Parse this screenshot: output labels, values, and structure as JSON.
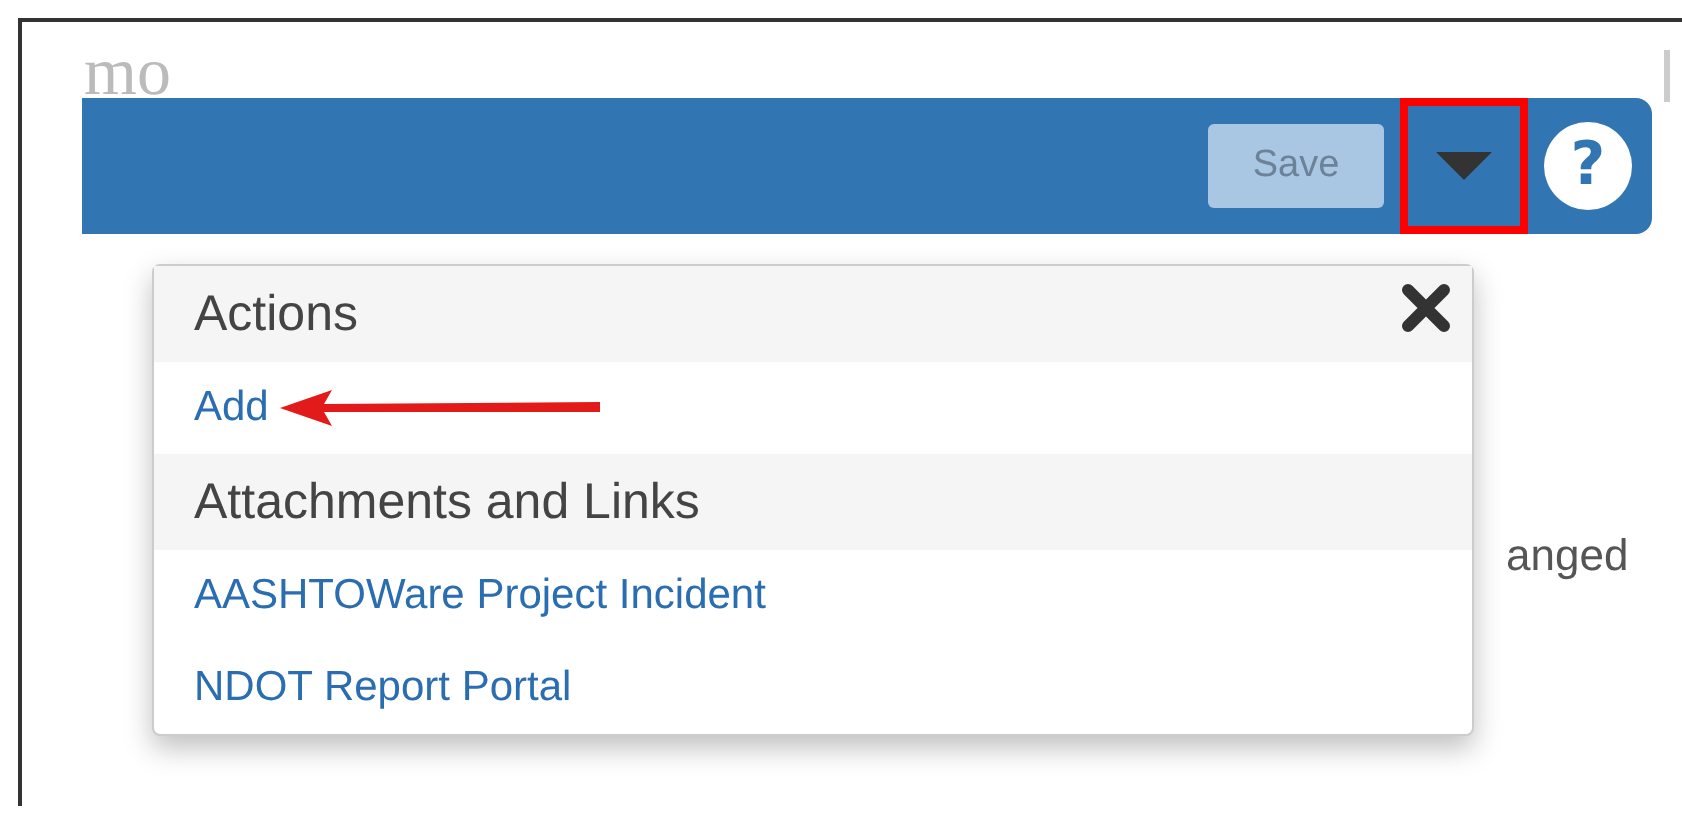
{
  "page": {
    "heading": "mo",
    "background_text": "anged"
  },
  "toolbar": {
    "save_button": {
      "label": "Save",
      "disabled": true
    },
    "menu_button": {
      "highlighted": true
    },
    "help_button": {
      "label": "?"
    }
  },
  "dropdown": {
    "sections": [
      {
        "title": "Actions",
        "closable": true,
        "items": [
          {
            "label": "Add",
            "annotated": true
          }
        ]
      },
      {
        "title": "Attachments and Links",
        "closable": false,
        "items": [
          {
            "label": "AASHTOWare Project Incident",
            "annotated": false
          },
          {
            "label": "NDOT Report Portal",
            "annotated": false
          }
        ]
      }
    ]
  }
}
